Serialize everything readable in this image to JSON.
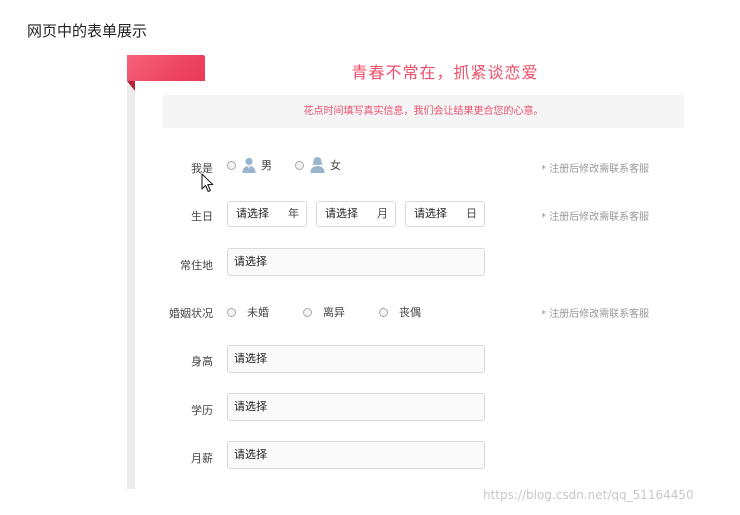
{
  "page": {
    "title": "网页中的表单展示"
  },
  "header": {
    "slogan": "青春不常在，抓紧谈恋爱",
    "notice": "花点时间填写真实信息，我们会让结果更合您的心意。",
    "accent_color": "#ef4f6a"
  },
  "form": {
    "gender": {
      "label": "我是",
      "options": [
        {
          "label": "男",
          "icon": "male-user-icon"
        },
        {
          "label": "女",
          "icon": "female-user-icon"
        }
      ],
      "hint": "* 注册后修改需联系客服"
    },
    "birthday": {
      "label": "生日",
      "fields": [
        {
          "value": "请选择",
          "unit": "年"
        },
        {
          "value": "请选择",
          "unit": "月"
        },
        {
          "value": "请选择",
          "unit": "日"
        }
      ],
      "hint": "* 注册后修改需联系客服"
    },
    "residence": {
      "label": "常住地",
      "value": "请选择"
    },
    "marital": {
      "label": "婚姻状况",
      "options": [
        "未婚",
        "离异",
        "丧偶"
      ],
      "hint": "* 注册后修改需联系客服"
    },
    "height": {
      "label": "身高",
      "value": "请选择"
    },
    "education": {
      "label": "学历",
      "value": "请选择"
    },
    "salary": {
      "label": "月薪",
      "value": "请选择"
    }
  },
  "watermark": "https://blog.csdn.net/qq_51164450"
}
